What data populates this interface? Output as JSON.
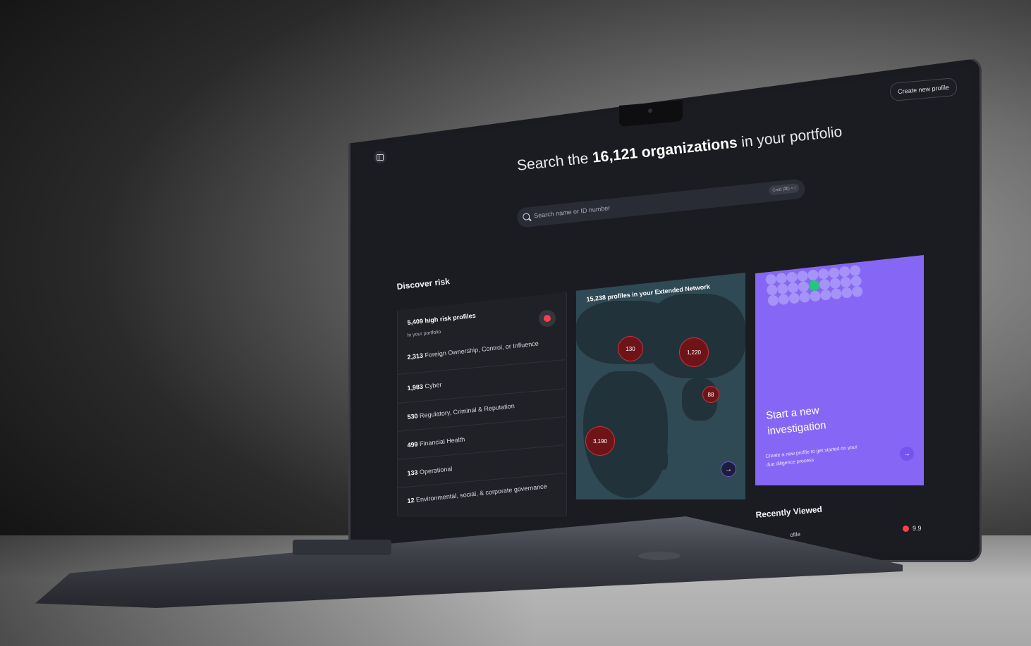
{
  "header": {
    "create_button": "Create new profile",
    "headline_prefix": "Search the",
    "headline_count": "16,121 organizations",
    "headline_suffix": "in your portfolio"
  },
  "search": {
    "placeholder": "Search name or ID number",
    "shortcut": "Cmd (⌘) + /"
  },
  "discover": {
    "title": "Discover risk",
    "high_risk": {
      "count_label": "5,409 high risk profiles",
      "subtitle": "In your portfolio"
    },
    "categories": [
      {
        "count": "2,313",
        "label": "Foreign Ownership, Control, or Influence"
      },
      {
        "count": "1,983",
        "label": "Cyber"
      },
      {
        "count": "530",
        "label": "Regulatory, Criminal & Reputation"
      },
      {
        "count": "499",
        "label": "Financial Health"
      },
      {
        "count": "133",
        "label": "Operational"
      },
      {
        "count": "12",
        "label": "Environmental, social, & corporate governance"
      }
    ]
  },
  "map": {
    "title": "15,238 profiles in your Extended Network",
    "bubbles": [
      "130",
      "1,220",
      "88",
      "3,190"
    ]
  },
  "promo": {
    "title": "Start a new investigation",
    "subtitle": "Create a new profile to get started on your due diligence process"
  },
  "recent": {
    "title": "Recently Viewed",
    "item_label": "ofile",
    "score": "9.9"
  },
  "colors": {
    "accent_purple": "#8667f5",
    "risk_red": "#ff3d4a",
    "screen_bg": "#1b1c21",
    "map_water": "#2f4a55"
  }
}
